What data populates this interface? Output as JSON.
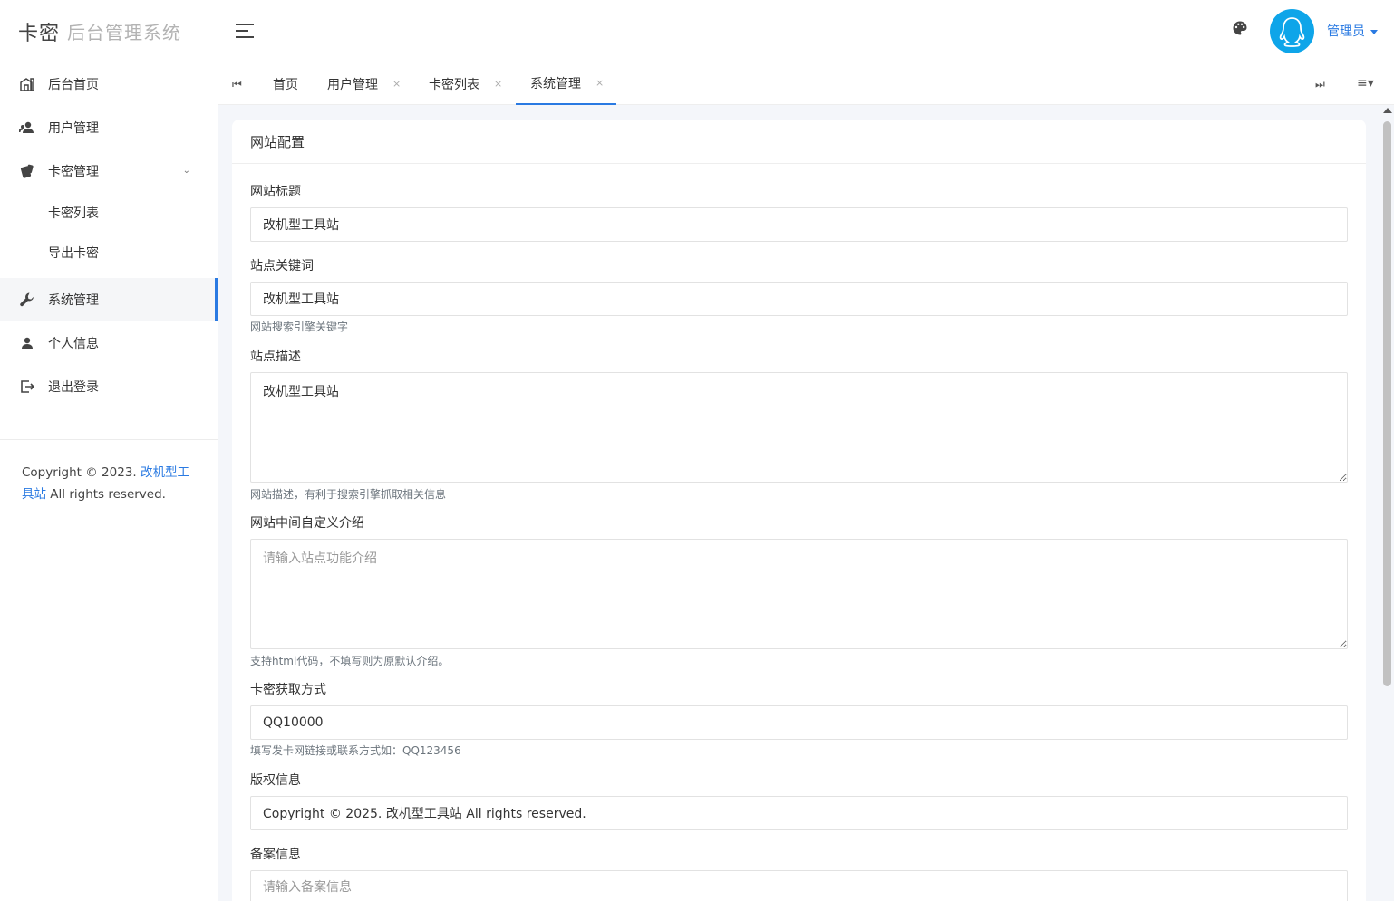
{
  "brand": {
    "main": "卡密",
    "sub": "后台管理系统"
  },
  "sidebar": {
    "items": [
      {
        "label": "后台首页",
        "icon": "home-icon"
      },
      {
        "label": "用户管理",
        "icon": "users-icon"
      },
      {
        "label": "卡密管理",
        "icon": "cards-icon",
        "expanded": true
      },
      {
        "label": "系统管理",
        "icon": "wrench-icon",
        "active": true
      },
      {
        "label": "个人信息",
        "icon": "person-icon"
      },
      {
        "label": "退出登录",
        "icon": "logout-icon"
      }
    ],
    "subitems": [
      {
        "label": "卡密列表"
      },
      {
        "label": "导出卡密"
      }
    ],
    "copyright": {
      "prefix": "Copyright © 2023. ",
      "link": "改机型工具站",
      "suffix": " All rights reserved."
    }
  },
  "header": {
    "user": "管理员"
  },
  "tabs": [
    {
      "label": "首页",
      "closable": false
    },
    {
      "label": "用户管理",
      "closable": true
    },
    {
      "label": "卡密列表",
      "closable": true
    },
    {
      "label": "系统管理",
      "closable": true,
      "active": true
    }
  ],
  "tab_close_glyph": "×",
  "card": {
    "title": "网站配置",
    "fields": {
      "title": {
        "label": "网站标题",
        "value": "改机型工具站"
      },
      "keywords": {
        "label": "站点关键词",
        "value": "改机型工具站",
        "help": "网站搜索引擎关键字"
      },
      "description": {
        "label": "站点描述",
        "value": "改机型工具站",
        "help": "网站描述，有利于搜索引擎抓取相关信息"
      },
      "intro": {
        "label": "网站中间自定义介绍",
        "value": "",
        "placeholder": "请输入站点功能介绍",
        "help": "支持html代码，不填写则为原默认介绍。"
      },
      "card_method": {
        "label": "卡密获取方式",
        "value": "QQ10000",
        "help": "填写发卡网链接或联系方式如：QQ123456"
      },
      "copyright": {
        "label": "版权信息",
        "value": "Copyright © 2025. 改机型工具站 All rights reserved."
      },
      "icp": {
        "label": "备案信息",
        "value": "",
        "placeholder": "请输入备案信息"
      }
    }
  },
  "colors": {
    "accent": "#2a7ae2",
    "avatar": "#0ea5e9"
  }
}
